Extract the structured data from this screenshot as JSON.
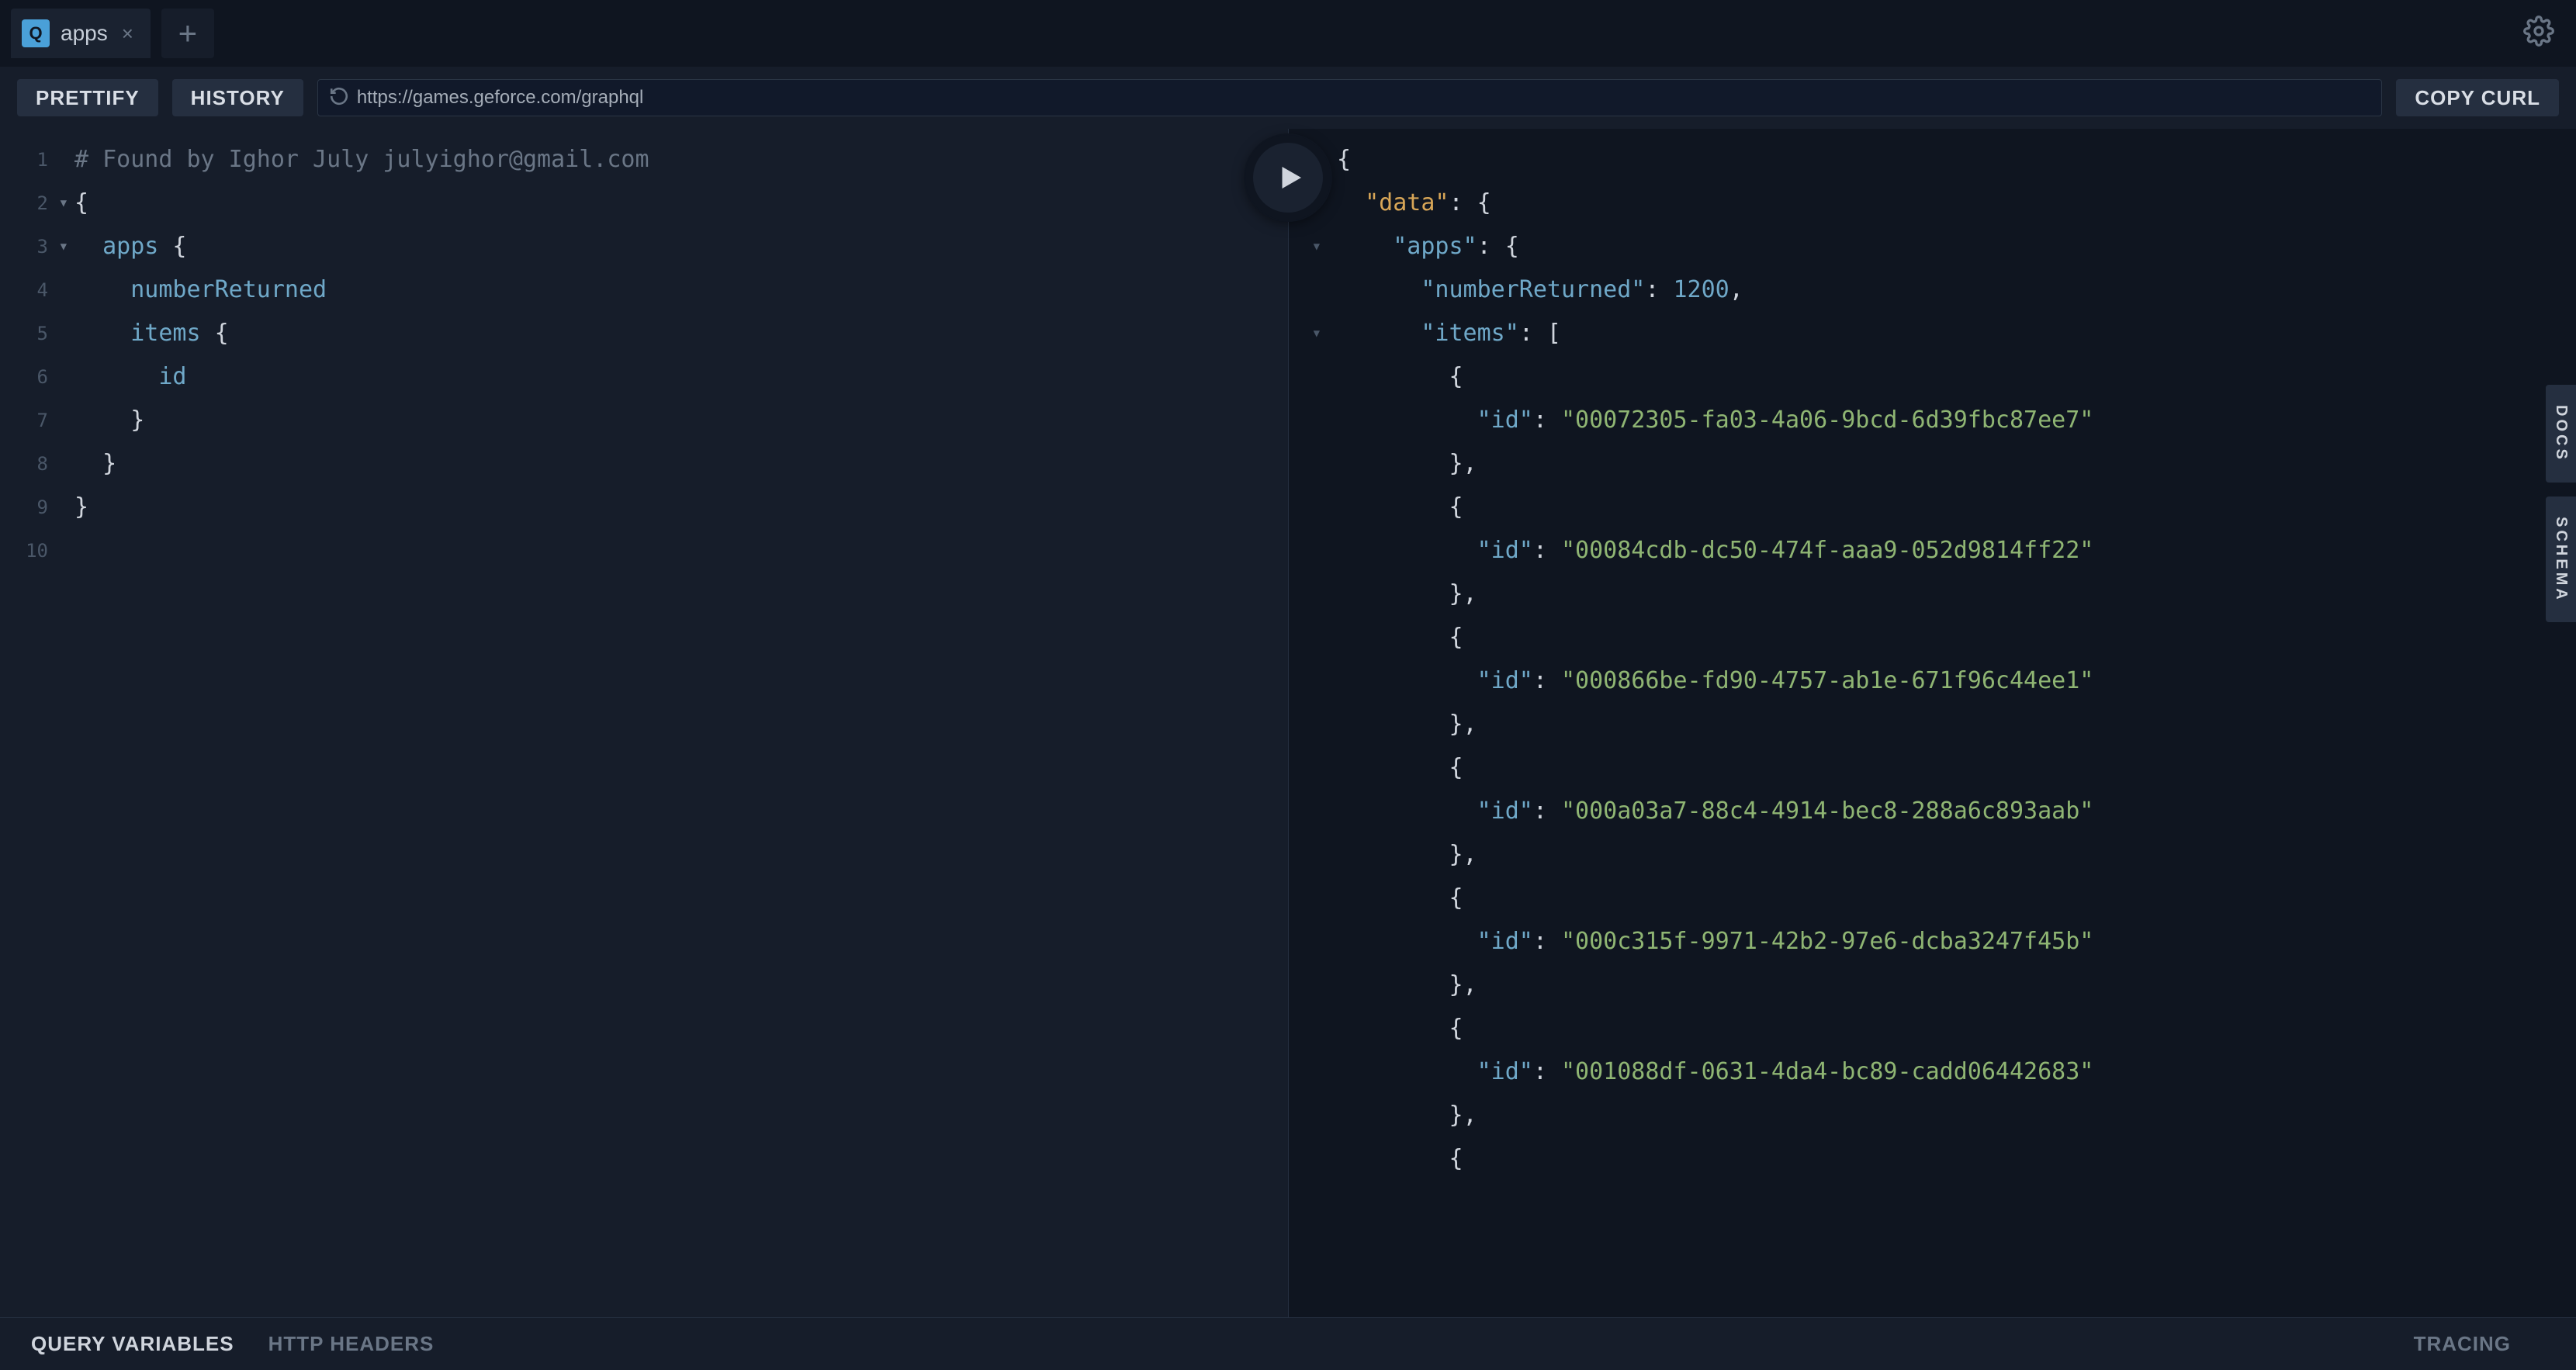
{
  "tabs": [
    {
      "icon": "Q",
      "label": "apps"
    }
  ],
  "toolbar": {
    "prettify": "PRETTIFY",
    "history": "HISTORY",
    "copy_curl": "COPY CURL",
    "url": "https://games.geforce.com/graphql"
  },
  "query": {
    "lines": [
      {
        "n": 1,
        "fold": false,
        "text": "# Found by Ighor July julyighor@gmail.com",
        "cls": "comment"
      },
      {
        "n": 2,
        "fold": true,
        "text": "{",
        "cls": "tok-brace"
      },
      {
        "n": 3,
        "fold": true,
        "text": "  apps {",
        "tokens": [
          [
            "  ",
            ""
          ],
          [
            "apps",
            "tok-field"
          ],
          [
            " {",
            "tok-brace"
          ]
        ]
      },
      {
        "n": 4,
        "fold": false,
        "text": "    numberReturned",
        "cls": "tok-field"
      },
      {
        "n": 5,
        "fold": false,
        "text": "    items {",
        "tokens": [
          [
            "    ",
            ""
          ],
          [
            "items",
            "tok-field"
          ],
          [
            " {",
            "tok-brace"
          ]
        ]
      },
      {
        "n": 6,
        "fold": false,
        "text": "      id",
        "cls": "tok-field"
      },
      {
        "n": 7,
        "fold": false,
        "text": "    }",
        "cls": "tok-brace"
      },
      {
        "n": 8,
        "fold": false,
        "text": "  }",
        "cls": "tok-brace"
      },
      {
        "n": 9,
        "fold": false,
        "text": "}",
        "cls": "tok-brace"
      },
      {
        "n": 10,
        "fold": false,
        "text": ""
      }
    ]
  },
  "result": {
    "fold_rows": [
      1,
      2,
      3,
      5
    ],
    "tokens": [
      [
        [
          "{",
          "j-punc"
        ]
      ],
      [
        [
          "  ",
          ""
        ],
        [
          "\"data\"",
          "j-key-hl"
        ],
        [
          ": {",
          "j-punc"
        ]
      ],
      [
        [
          "    ",
          ""
        ],
        [
          "\"apps\"",
          "j-key"
        ],
        [
          ": {",
          "j-punc"
        ]
      ],
      [
        [
          "      ",
          ""
        ],
        [
          "\"numberReturned\"",
          "j-key"
        ],
        [
          ": ",
          "j-punc"
        ],
        [
          "1200",
          "j-num"
        ],
        [
          ",",
          "j-punc"
        ]
      ],
      [
        [
          "      ",
          ""
        ],
        [
          "\"items\"",
          "j-key"
        ],
        [
          ": [",
          "j-punc"
        ]
      ],
      [
        [
          "        {",
          "j-punc"
        ]
      ],
      [
        [
          "          ",
          ""
        ],
        [
          "\"id\"",
          "j-key"
        ],
        [
          ": ",
          "j-punc"
        ],
        [
          "\"00072305-fa03-4a06-9bcd-6d39fbc87ee7\"",
          "j-str"
        ]
      ],
      [
        [
          "        },",
          "j-punc"
        ]
      ],
      [
        [
          "        {",
          "j-punc"
        ]
      ],
      [
        [
          "          ",
          ""
        ],
        [
          "\"id\"",
          "j-key"
        ],
        [
          ": ",
          "j-punc"
        ],
        [
          "\"00084cdb-dc50-474f-aaa9-052d9814ff22\"",
          "j-str"
        ]
      ],
      [
        [
          "        },",
          "j-punc"
        ]
      ],
      [
        [
          "        {",
          "j-punc"
        ]
      ],
      [
        [
          "          ",
          ""
        ],
        [
          "\"id\"",
          "j-key"
        ],
        [
          ": ",
          "j-punc"
        ],
        [
          "\"000866be-fd90-4757-ab1e-671f96c44ee1\"",
          "j-str"
        ]
      ],
      [
        [
          "        },",
          "j-punc"
        ]
      ],
      [
        [
          "        {",
          "j-punc"
        ]
      ],
      [
        [
          "          ",
          ""
        ],
        [
          "\"id\"",
          "j-key"
        ],
        [
          ": ",
          "j-punc"
        ],
        [
          "\"000a03a7-88c4-4914-bec8-288a6c893aab\"",
          "j-str"
        ]
      ],
      [
        [
          "        },",
          "j-punc"
        ]
      ],
      [
        [
          "        {",
          "j-punc"
        ]
      ],
      [
        [
          "          ",
          ""
        ],
        [
          "\"id\"",
          "j-key"
        ],
        [
          ": ",
          "j-punc"
        ],
        [
          "\"000c315f-9971-42b2-97e6-dcba3247f45b\"",
          "j-str"
        ]
      ],
      [
        [
          "        },",
          "j-punc"
        ]
      ],
      [
        [
          "        {",
          "j-punc"
        ]
      ],
      [
        [
          "          ",
          ""
        ],
        [
          "\"id\"",
          "j-key"
        ],
        [
          ": ",
          "j-punc"
        ],
        [
          "\"001088df-0631-4da4-bc89-cadd06442683\"",
          "j-str"
        ]
      ],
      [
        [
          "        },",
          "j-punc"
        ]
      ],
      [
        [
          "        {",
          "j-punc"
        ]
      ]
    ]
  },
  "dock": {
    "docs": "DOCS",
    "schema": "SCHEMA"
  },
  "bottom": {
    "query_variables": "QUERY VARIABLES",
    "http_headers": "HTTP HEADERS",
    "tracing": "TRACING"
  }
}
